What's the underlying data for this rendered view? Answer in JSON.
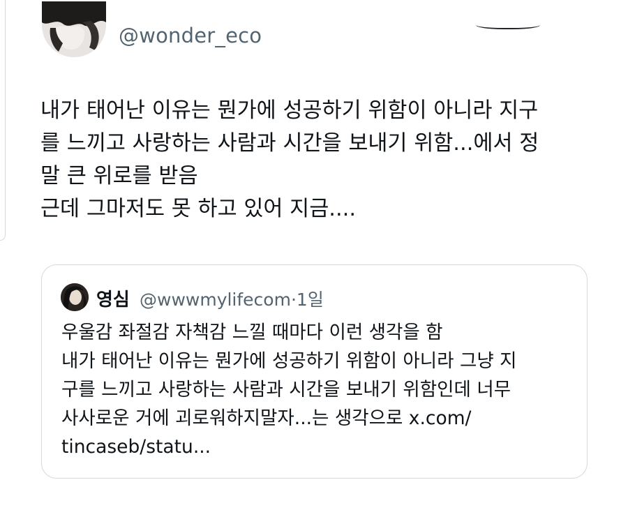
{
  "tweet": {
    "handle": "@wonder_eco",
    "lines": [
      "내가 태어난 이유는 뭔가에 성공하기 위함이 아니라 지구",
      "를 느끼고 사랑하는 사람과 시간을 보내기 위함...에서 정",
      "말 큰 위로를 받음",
      "근데 그마저도 못 하고 있어 지금...."
    ]
  },
  "quote": {
    "name": "영심",
    "handle": "@wwwmylifecom",
    "separator": "·",
    "time": "1일",
    "lines": [
      "우울감 좌절감 자책감 느낄 때마다 이런 생각을 함",
      "내가 태어난 이유는 뭔가에 성공하기 위함이 아니라 그냥 지",
      "구를 느끼고 사랑하는 사람과 시간을 보내기 위함인데 너무",
      "사사로운 거에 괴로워하지말자...는 생각으로 x.com/",
      "tincaseb/statu..."
    ]
  },
  "colors": {
    "text": "#0f1419",
    "secondary": "#536471",
    "border": "#cfd9de"
  },
  "icons": {
    "main_avatar": "profile-photo",
    "quote_avatar": "profile-photo"
  }
}
